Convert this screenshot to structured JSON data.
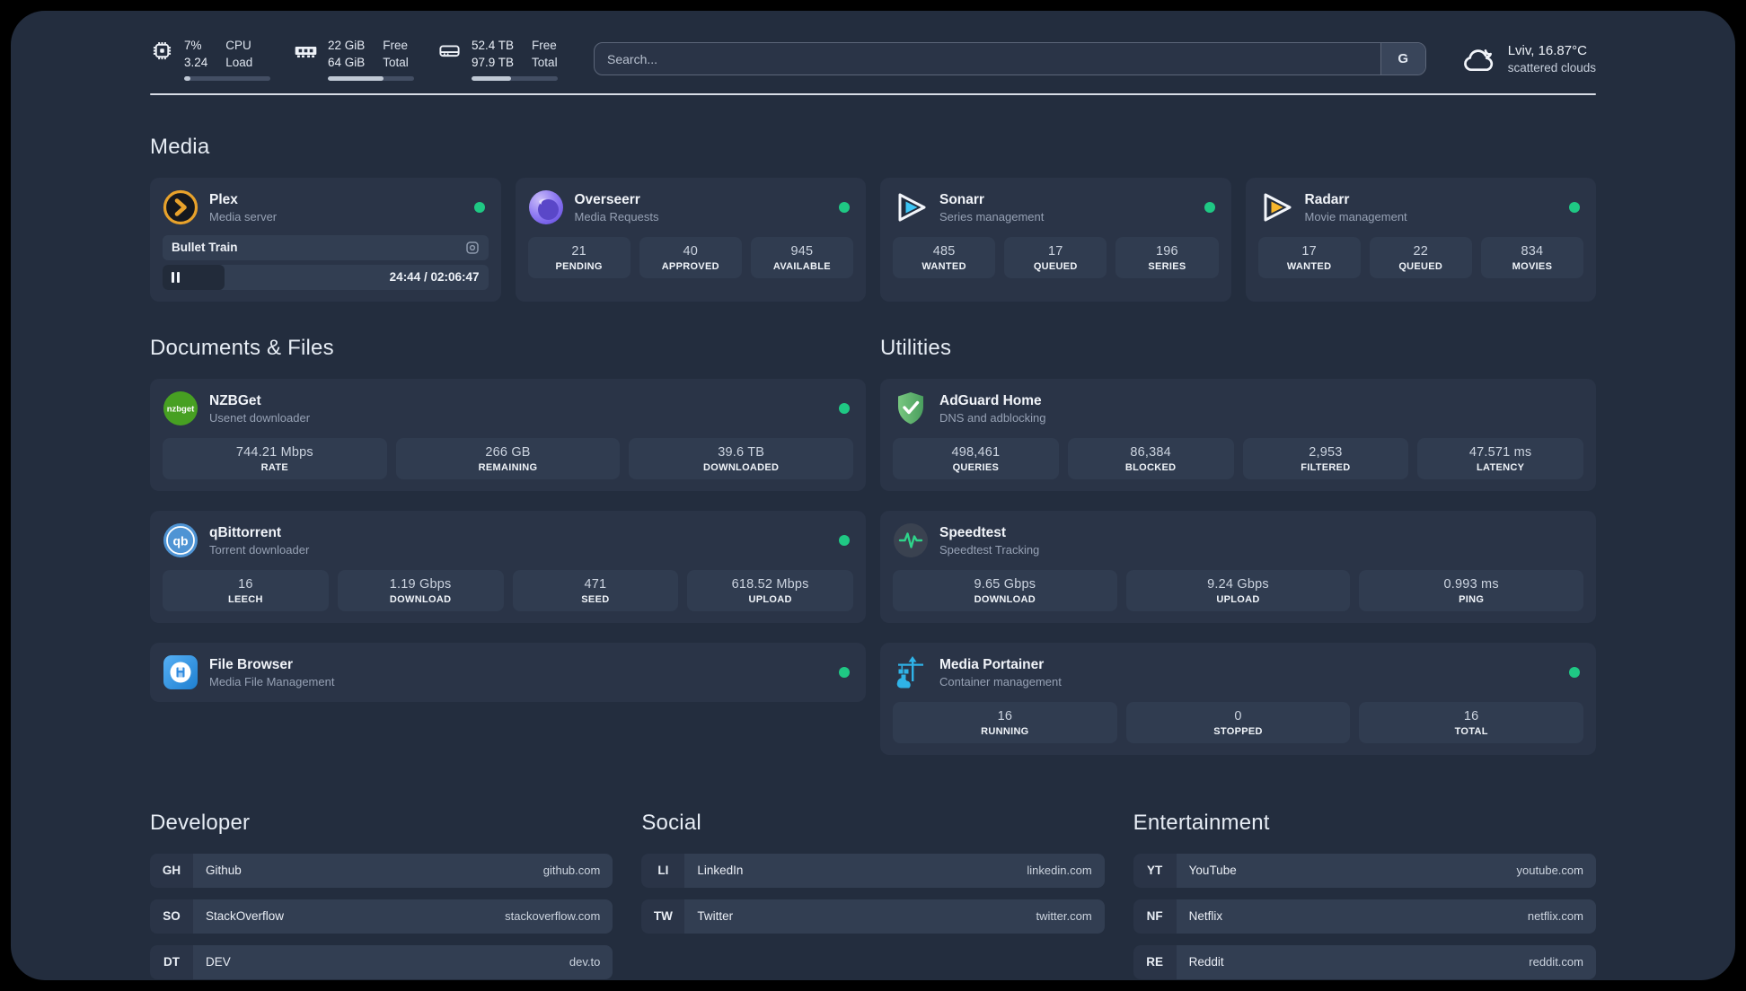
{
  "page": {
    "colors": {
      "background": "#000000",
      "surface": "#232d3e",
      "card": "#2a3447",
      "tile": "#303c50",
      "accent_green": "#1fc884",
      "text_primary": "#f1f4f9",
      "text_secondary": "#96a1b4"
    }
  },
  "icons": {
    "cpu-icon": "chip outline",
    "memory-icon": "ram stick",
    "disk-icon": "hard drive",
    "search-engine-button": "G",
    "weather-icon": "cloud outline",
    "status-dot": "green circle",
    "pause-icon": "two bars",
    "camera-icon": "webcam outline"
  },
  "topbar": {
    "cpu": {
      "value_top": "7%",
      "value_bottom": "3.24",
      "label_top": "CPU",
      "label_bottom": "Load",
      "progress_pct": 7
    },
    "memory": {
      "value_top": "22 GiB",
      "value_bottom": "64 GiB",
      "label_top": "Free",
      "label_bottom": "Total",
      "progress_pct": 65
    },
    "disk": {
      "value_top": "52.4 TB",
      "value_bottom": "97.9 TB",
      "label_top": "Free",
      "label_bottom": "Total",
      "progress_pct": 46
    },
    "search": {
      "placeholder": "Search...",
      "engine_button": "G"
    },
    "weather": {
      "location": "Lviv, 16.87°C",
      "condition": "scattered clouds"
    }
  },
  "sections": {
    "media": "Media",
    "documents": "Documents & Files",
    "utilities": "Utilities",
    "developer": "Developer",
    "social": "Social",
    "entertainment": "Entertainment"
  },
  "services": {
    "plex": {
      "name": "Plex",
      "description": "Media server",
      "status": "online",
      "now_playing": {
        "title": "Bullet Train",
        "elapsed": "24:44",
        "duration": "02:06:47",
        "time": "24:44 / 02:06:47",
        "progress_pct": 19
      }
    },
    "overseerr": {
      "name": "Overseerr",
      "description": "Media Requests",
      "status": "online",
      "stats": [
        {
          "value": "21",
          "label": "PENDING"
        },
        {
          "value": "40",
          "label": "APPROVED"
        },
        {
          "value": "945",
          "label": "AVAILABLE"
        }
      ]
    },
    "sonarr": {
      "name": "Sonarr",
      "description": "Series management",
      "status": "online",
      "stats": [
        {
          "value": "485",
          "label": "WANTED"
        },
        {
          "value": "17",
          "label": "QUEUED"
        },
        {
          "value": "196",
          "label": "SERIES"
        }
      ]
    },
    "radarr": {
      "name": "Radarr",
      "description": "Movie management",
      "status": "online",
      "stats": [
        {
          "value": "17",
          "label": "WANTED"
        },
        {
          "value": "22",
          "label": "QUEUED"
        },
        {
          "value": "834",
          "label": "MOVIES"
        }
      ]
    },
    "nzbget": {
      "name": "NZBGet",
      "description": "Usenet downloader",
      "status": "online",
      "stats": [
        {
          "value": "744.21 Mbps",
          "label": "RATE"
        },
        {
          "value": "266 GB",
          "label": "REMAINING"
        },
        {
          "value": "39.6 TB",
          "label": "DOWNLOADED"
        }
      ]
    },
    "qbittorrent": {
      "name": "qBittorrent",
      "description": "Torrent downloader",
      "status": "online",
      "stats": [
        {
          "value": "16",
          "label": "LEECH"
        },
        {
          "value": "1.19 Gbps",
          "label": "DOWNLOAD"
        },
        {
          "value": "471",
          "label": "SEED"
        },
        {
          "value": "618.52 Mbps",
          "label": "UPLOAD"
        }
      ]
    },
    "filebrowser": {
      "name": "File Browser",
      "description": "Media File Management",
      "status": "online"
    },
    "adguard": {
      "name": "AdGuard Home",
      "description": "DNS and adblocking",
      "stats": [
        {
          "value": "498,461",
          "label": "QUERIES"
        },
        {
          "value": "86,384",
          "label": "BLOCKED"
        },
        {
          "value": "2,953",
          "label": "FILTERED"
        },
        {
          "value": "47.571 ms",
          "label": "LATENCY"
        }
      ]
    },
    "speedtest": {
      "name": "Speedtest",
      "description": "Speedtest Tracking",
      "stats": [
        {
          "value": "9.65 Gbps",
          "label": "DOWNLOAD"
        },
        {
          "value": "9.24 Gbps",
          "label": "UPLOAD"
        },
        {
          "value": "0.993 ms",
          "label": "PING"
        }
      ]
    },
    "portainer": {
      "name": "Media Portainer",
      "description": "Container management",
      "status": "online",
      "stats": [
        {
          "value": "16",
          "label": "RUNNING"
        },
        {
          "value": "0",
          "label": "STOPPED"
        },
        {
          "value": "16",
          "label": "TOTAL"
        }
      ]
    }
  },
  "bookmarks": {
    "developer": [
      {
        "abbr": "GH",
        "name": "Github",
        "url": "github.com"
      },
      {
        "abbr": "SO",
        "name": "StackOverflow",
        "url": "stackoverflow.com"
      },
      {
        "abbr": "DT",
        "name": "DEV",
        "url": "dev.to"
      }
    ],
    "social": [
      {
        "abbr": "LI",
        "name": "LinkedIn",
        "url": "linkedin.com"
      },
      {
        "abbr": "TW",
        "name": "Twitter",
        "url": "twitter.com"
      }
    ],
    "entertainment": [
      {
        "abbr": "YT",
        "name": "YouTube",
        "url": "youtube.com"
      },
      {
        "abbr": "NF",
        "name": "Netflix",
        "url": "netflix.com"
      },
      {
        "abbr": "RE",
        "name": "Reddit",
        "url": "reddit.com"
      }
    ]
  }
}
